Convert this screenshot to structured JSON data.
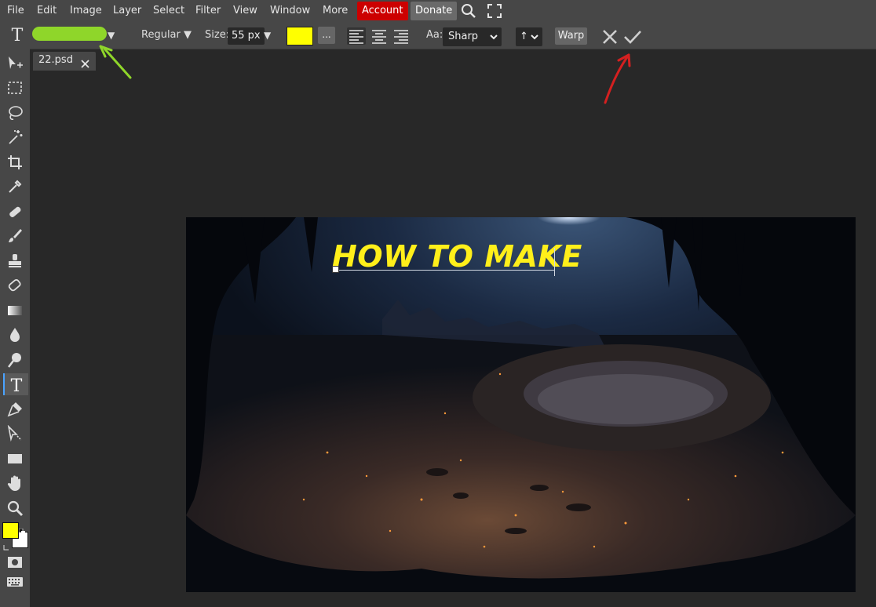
{
  "menu": {
    "items": [
      "File",
      "Edit",
      "Image",
      "Layer",
      "Select",
      "Filter",
      "View",
      "Window",
      "More"
    ],
    "account_label": "Account",
    "donate_label": "Donate",
    "account_color": "#cc0000",
    "donate_color": "#6a6a6a"
  },
  "options": {
    "font_style": "Regular ▼",
    "size_label": "Size:",
    "size_value": "55 px",
    "text_color": "#ffff00",
    "more_label": "...",
    "aa_label": "Aa:",
    "aa_value": "Sharp",
    "direction_value": "↑",
    "warp_label": "Warp",
    "font_dropdown_arrow": "▼",
    "size_arrow": "▼"
  },
  "document": {
    "tab_label": "22.psd",
    "canvas_text": "HOW TO MAKE"
  },
  "colors": {
    "foreground": "#ffff00",
    "background": "#ffffff",
    "annotation_green": "#8fd62a",
    "annotation_red": "#d42020"
  }
}
